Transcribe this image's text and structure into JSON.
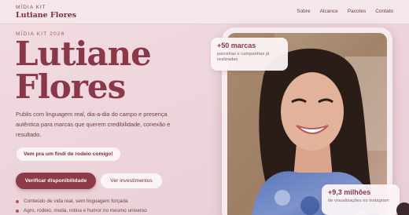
{
  "nav": {
    "brand_kicker": "MÍDIA KIT",
    "brand_name": "Lutiane Flores",
    "links": [
      "Sobre",
      "Alcance",
      "Pacotes",
      "Contato"
    ]
  },
  "hero": {
    "kicker": "MÍDIA KIT 2026",
    "title_line1": "Lutiane",
    "title_line2": "Flores",
    "lead": "Publis com linguagem real, dia-a-dia do campo e presença autêntica para marcas que querem credibilidade, conexão e resultado.",
    "pill_link": "Vem pra um findi de rodeio comigo!",
    "primary_button": "Verificar disponibilidade",
    "secondary_button": "Ver investimentos",
    "bullets": [
      "Conteúdo de vida real, sem linguagem forçada",
      "Agro, rodeio, moda, rotina e humor no mesmo universo"
    ]
  },
  "stats": {
    "top": {
      "value": "+50 marcas",
      "label": "parceiras e campanhas já realizadas"
    },
    "bottom": {
      "value": "+9,3 milhões",
      "label": "de visualizações no instagram"
    }
  },
  "colors": {
    "accent": "#8d3a49",
    "title": "#8a3747",
    "background": "#ecd4da"
  }
}
